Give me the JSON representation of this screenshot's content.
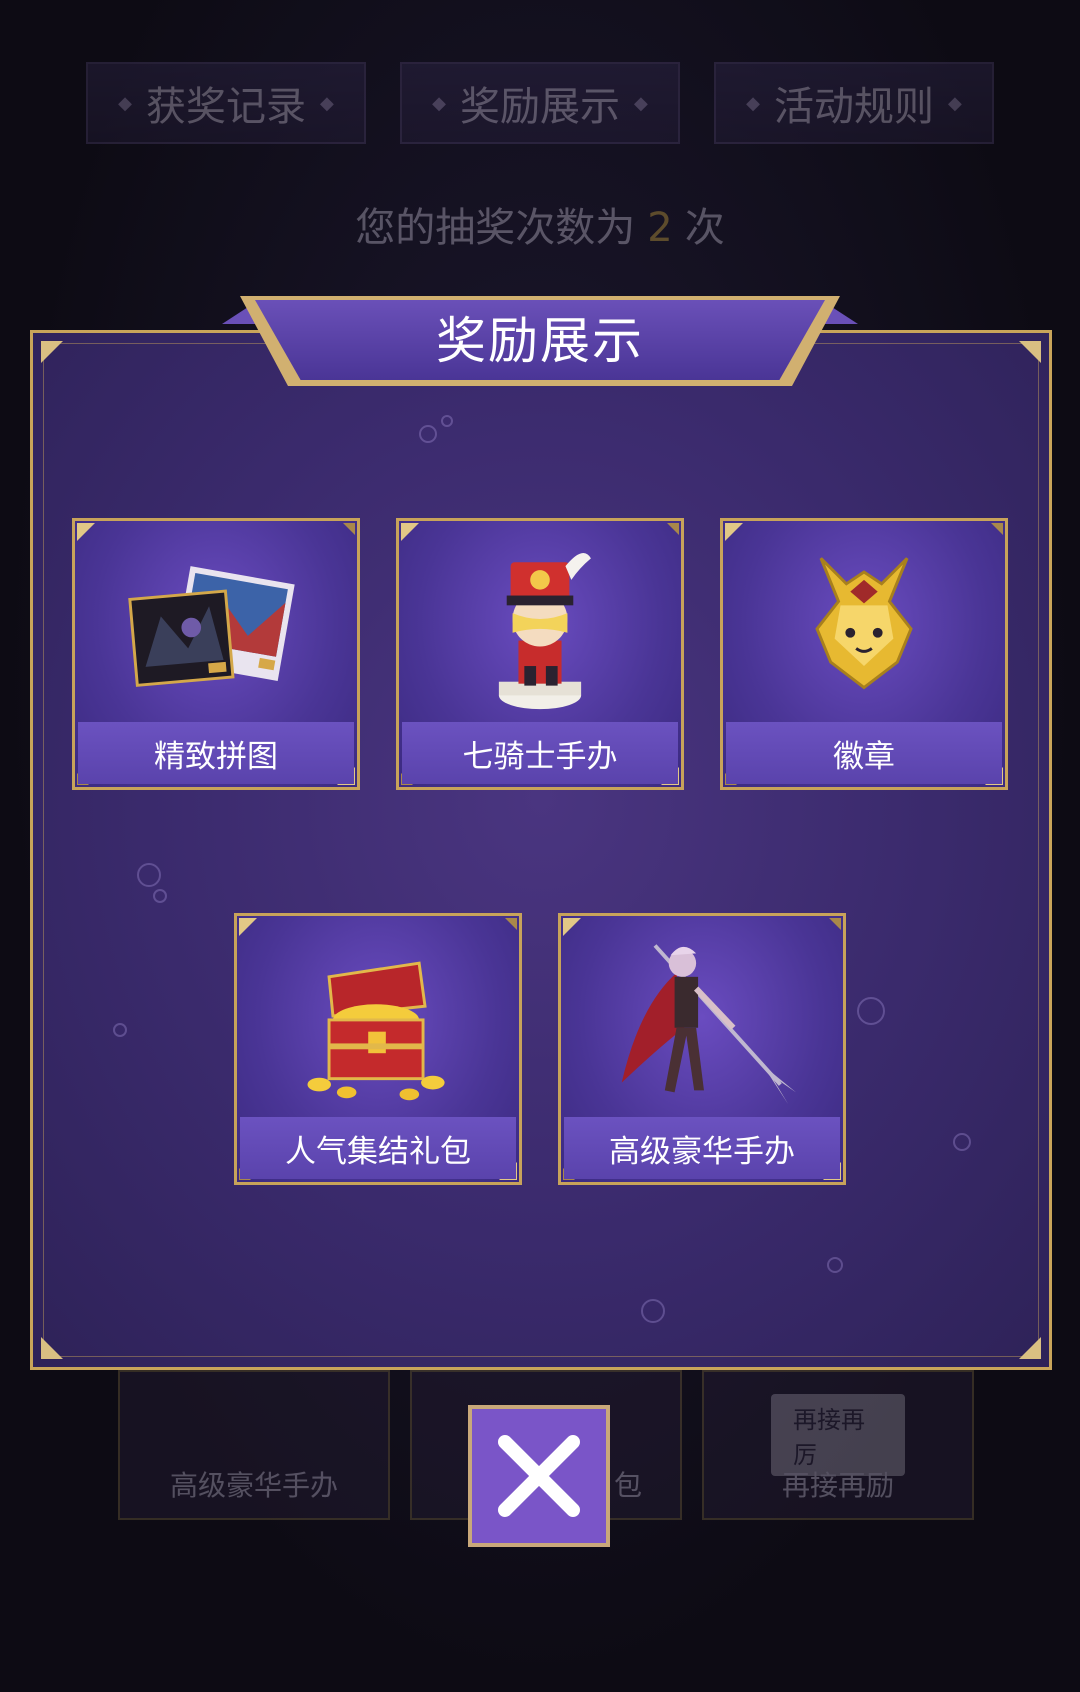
{
  "background": {
    "tabs": [
      "获奖记录",
      "奖励展示",
      "活动规则"
    ],
    "draws_prefix": "您的抽奖次数为",
    "draws_count": "2",
    "draws_suffix": "次",
    "cards": [
      {
        "label": "高级豪华手办",
        "ribbon": ""
      },
      {
        "label": "包",
        "ribbon": ""
      },
      {
        "label": "再接再励",
        "ribbon": "再接再厉"
      }
    ]
  },
  "modal": {
    "title": "奖励展示",
    "prizes": [
      {
        "label": "精致拼图",
        "icon": "puzzle-box-icon"
      },
      {
        "label": "七骑士手办",
        "icon": "knight-figure-icon"
      },
      {
        "label": "徽章",
        "icon": "badge-icon"
      },
      {
        "label": "人气集结礼包",
        "icon": "treasure-chest-icon"
      },
      {
        "label": "高级豪华手办",
        "icon": "warrior-figure-icon"
      }
    ]
  },
  "close": {
    "icon": "close-icon"
  },
  "colors": {
    "accent_gold": "#c9a55a",
    "panel_purple": "#3a2a6c",
    "button_purple": "#7a55c8",
    "count_yellow": "#f4c542"
  }
}
